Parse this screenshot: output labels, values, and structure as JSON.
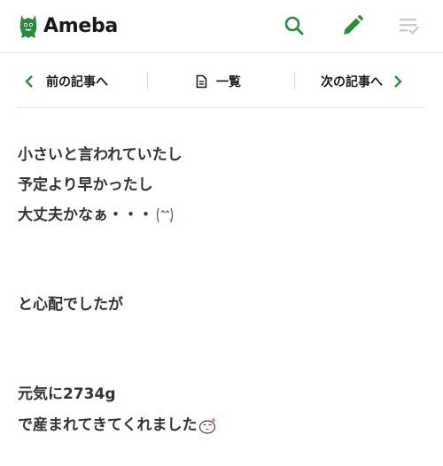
{
  "header": {
    "logo_text": "Ameba",
    "icons": {
      "search": "search-icon",
      "write": "pencil-icon",
      "feed": "feed-check-icon"
    }
  },
  "article_nav": {
    "prev_label": "前の記事へ",
    "list_label": "一覧",
    "next_label": "次の記事へ"
  },
  "body": {
    "lines": [
      "小さいと言われていたし",
      "予定より早かったし",
      "大丈夫かなぁ・・・",
      "と心配でしたが",
      "元気に2734g",
      "で産まれてきてくれました"
    ]
  },
  "colors": {
    "brand_green": "#2d8c3c",
    "icon_gray": "#cccccc",
    "text": "#333333",
    "divider": "#e6e6e6"
  }
}
